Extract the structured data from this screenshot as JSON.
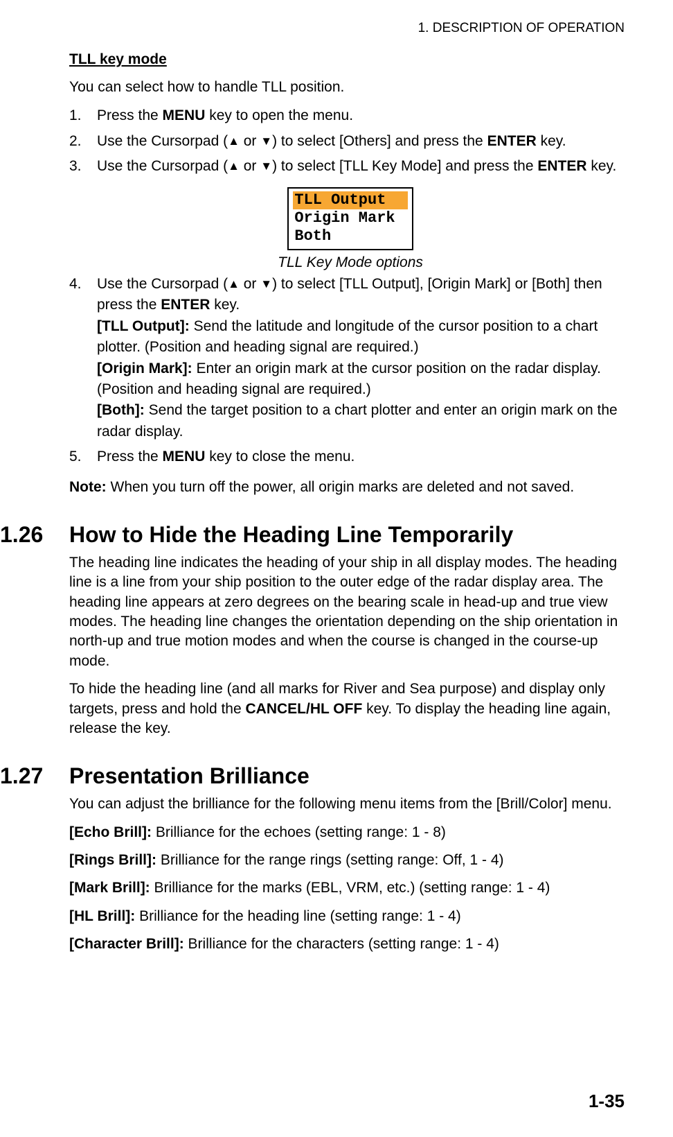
{
  "header": "1.  DESCRIPTION OF OPERATION",
  "tll": {
    "heading": "TLL key mode",
    "intro": "You can select how to handle TLL position.",
    "step1_num": "1.",
    "step1_a": "Press the ",
    "step1_b": "MENU",
    "step1_c": " key to open the menu.",
    "step2_num": "2.",
    "step2_a": "Use the Cursorpad (",
    "step2_b": " or ",
    "step2_c": ") to select [Others] and press the ",
    "step2_d": "ENTER",
    "step2_e": " key.",
    "step3_num": "3.",
    "step3_a": "Use the Cursorpad (",
    "step3_b": " or ",
    "step3_c": ") to select [TLL Key Mode] and press the ",
    "step3_d": "ENTER",
    "step3_e": " key.",
    "fig_opt1": "TLL Output",
    "fig_opt2": "Origin Mark",
    "fig_opt3": "Both",
    "fig_caption": "TLL Key Mode options",
    "step4_num": "4.",
    "step4_a": "Use the Cursorpad (",
    "step4_b": " or ",
    "step4_c": ") to select [TLL Output], [Origin Mark] or [Both] then press the ",
    "step4_d": "ENTER",
    "step4_e": " key.",
    "step4_tll_label": "[TLL Output]:",
    "step4_tll_text": " Send the latitude and longitude of the cursor position to a chart plotter. (Position and heading signal are required.)",
    "step4_om_label": "[Origin Mark]:",
    "step4_om_text": " Enter an origin mark at the cursor position on the radar display. (Position and heading signal are required.)",
    "step4_both_label": "[Both]:",
    "step4_both_text": " Send the target position to a chart plotter and enter an origin mark on the radar display.",
    "step5_num": "5.",
    "step5_a": "Press the ",
    "step5_b": "MENU",
    "step5_c": " key to close the menu.",
    "note_label": "Note:",
    "note_text": " When you turn off the power, all origin marks are deleted and not saved."
  },
  "s126": {
    "num": "1.26",
    "title": "How to Hide the Heading Line Temporarily",
    "p1": "The heading line indicates the heading of your ship in all display modes. The heading line is a line from your ship position to the outer edge of the radar display area. The heading line appears at zero degrees on the bearing scale in head-up and true view modes. The heading line changes the orientation depending on the ship orientation in north-up and true motion modes and when the course is changed in the course-up mode.",
    "p2a": "To hide the heading line (and all marks for River and Sea purpose) and display only targets, press and hold the ",
    "p2b": "CANCEL/HL OFF",
    "p2c": " key. To display the heading line again, release the key."
  },
  "s127": {
    "num": "1.27",
    "title": "Presentation Brilliance",
    "intro": "You can adjust the brilliance for the following menu items from the [Brill/Color] menu.",
    "echo_l": "[Echo Brill]:",
    "echo_t": " Brilliance for the echoes (setting range: 1 - 8)",
    "rings_l": "[Rings Brill]:",
    "rings_t": " Brilliance for the range rings (setting range: Off, 1 - 4)",
    "mark_l": "[Mark Brill]:",
    "mark_t": " Brilliance for the marks (EBL, VRM, etc.) (setting range: 1 - 4)",
    "hl_l": "[HL Brill]:",
    "hl_t": " Brilliance for the heading line (setting range: 1 - 4)",
    "char_l": "[Character Brill]:",
    "char_t": " Brilliance for the characters (setting range: 1 - 4)"
  },
  "footer": "1-35"
}
